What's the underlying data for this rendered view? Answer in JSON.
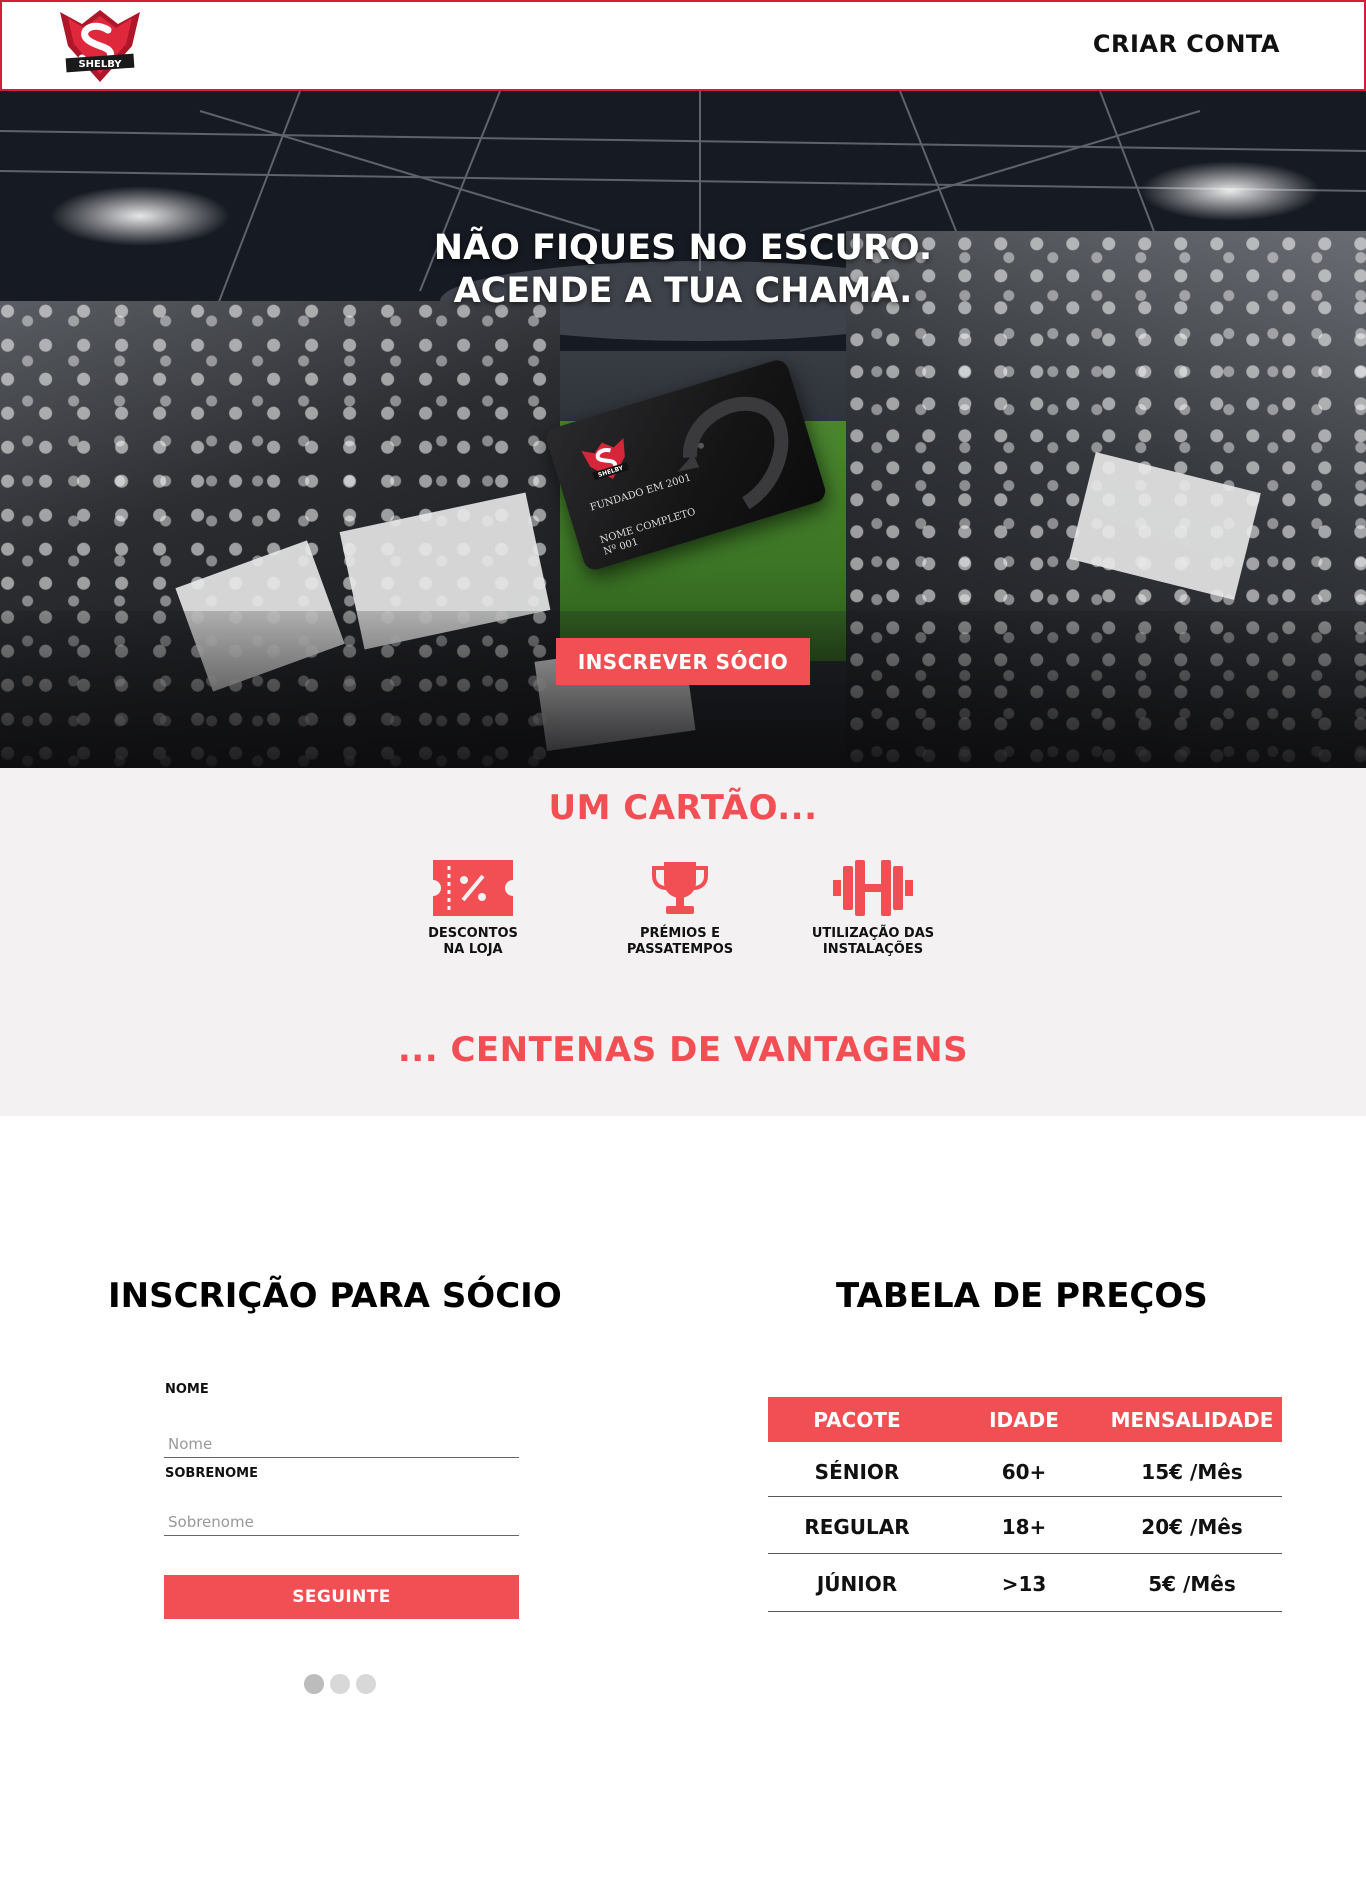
{
  "header": {
    "logo_text": "SHELBY",
    "criar_conta": "CRIAR CONTA"
  },
  "hero": {
    "title_line1": "NÃO FIQUES NO ESCURO.",
    "title_line2": "ACENDE A TUA CHAMA.",
    "card": {
      "logo_text": "SHELBY",
      "founded": "FUNDADO EM 2001",
      "name": "NOME COMPLETO",
      "number": "Nº 001"
    },
    "cta": "INSCREVER SÓCIO"
  },
  "benefits": {
    "title": "UM CARTÃO...",
    "items": [
      {
        "line1": "DESCONTOS",
        "line2": "NA LOJA",
        "icon": "discount-ticket-icon"
      },
      {
        "line1": "PRÉMIOS E",
        "line2": "PASSATEMPOS",
        "icon": "trophy-icon"
      },
      {
        "line1": "UTILIZAÇÃO DAS",
        "line2": "INSTALAÇÕES",
        "icon": "dumbbell-icon"
      }
    ],
    "subtitle": "... CENTENAS DE VANTAGENS"
  },
  "form": {
    "title": "INSCRIÇÃO PARA SÓCIO",
    "nome_label": "NOME",
    "nome_placeholder": "Nome",
    "sobrenome_label": "SOBRENOME",
    "sobrenome_placeholder": "Sobrenome",
    "submit": "SEGUINTE",
    "steps": 3,
    "current_step": 1
  },
  "pricing": {
    "title": "TABELA DE PREÇOS",
    "headers": [
      "PACOTE",
      "IDADE",
      "MENSALIDADE"
    ],
    "rows": [
      [
        "SÉNIOR",
        "60+",
        "15€ /Mês"
      ],
      [
        "REGULAR",
        "18+",
        "20€ /Mês"
      ],
      [
        "JÚNIOR",
        ">13",
        "5€ /Mês"
      ]
    ]
  },
  "colors": {
    "accent": "#f24f54",
    "header_border": "#cf1f3a",
    "benefits_bg": "#f3f1f1"
  }
}
